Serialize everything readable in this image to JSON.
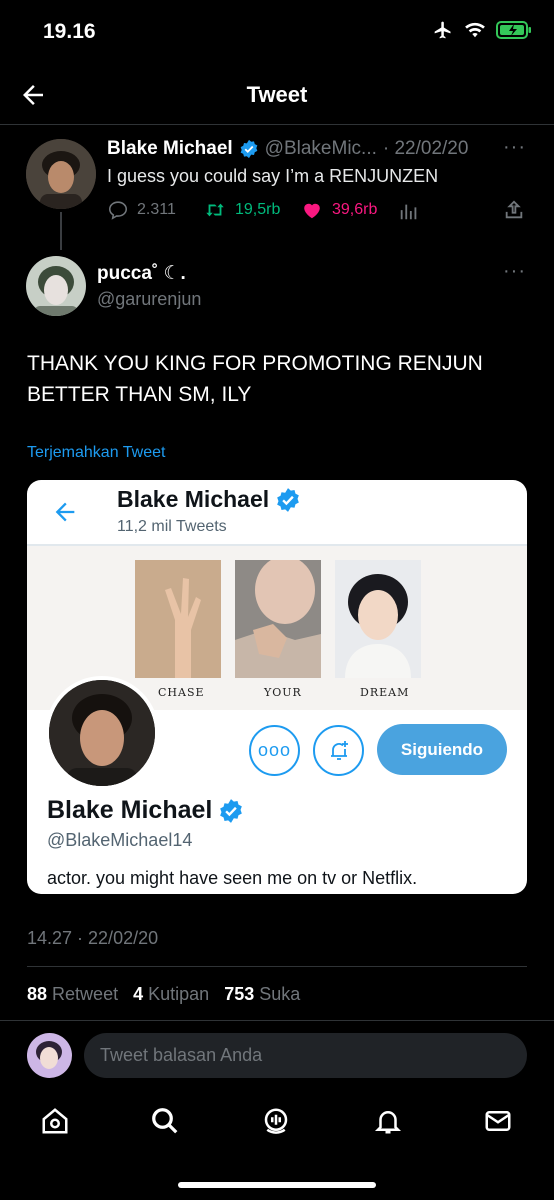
{
  "status_bar": {
    "time": "19.16"
  },
  "header": {
    "title": "Tweet"
  },
  "quoted_tweet": {
    "name": "Blake Michael",
    "handle": "@BlakeMic...",
    "date": "· 22/02/20",
    "text": "I guess you could say I’m a RENJUNZEN",
    "replies": "2.311",
    "retweets": "19,5rb",
    "likes": "39,6rb"
  },
  "main_tweet": {
    "name": "pucca˚ ☾.",
    "handle": "@garurenjun",
    "text": "THANK YOU KING FOR PROMOTING RENJUN BETTER THAN SM, ILY",
    "translate_label": "Terjemahkan Tweet"
  },
  "embedded_profile": {
    "name": "Blake Michael",
    "tweet_count": "11,2 mil Tweets",
    "banner_captions": [
      "CHASE",
      "YOUR",
      "DREAM"
    ],
    "handle": "@BlakeMichael14",
    "bio": "actor. you might have seen me on tv or Netflix.",
    "follow_label": "Siguiendo"
  },
  "meta": {
    "timestamp": "14.27 · 22/02/20",
    "retweet_count": "88",
    "retweet_label": "Retweet",
    "quote_count": "4",
    "quote_label": "Kutipan",
    "like_count": "753",
    "like_label": "Suka"
  },
  "reply": {
    "placeholder": "Tweet balasan Anda"
  },
  "colors": {
    "accent": "#1d9bf0",
    "retweet": "#00ba7c",
    "like": "#f91880",
    "background": "#000000"
  },
  "tab_icons": [
    "home-icon",
    "search-icon",
    "spaces-icon",
    "notifications-icon",
    "messages-icon"
  ]
}
